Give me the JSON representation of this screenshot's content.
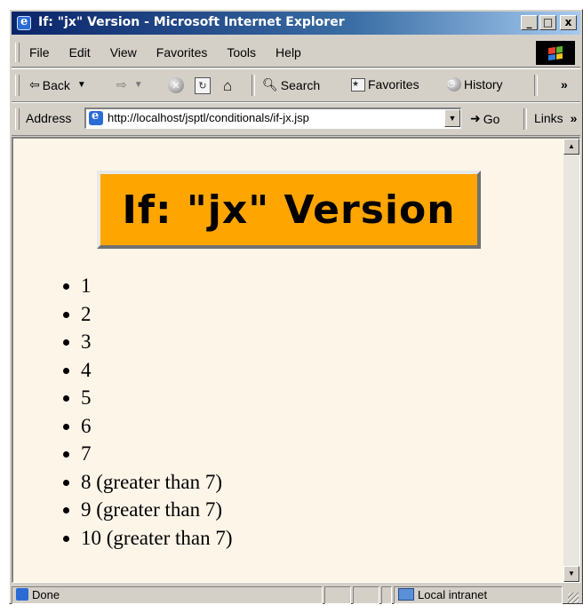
{
  "window": {
    "title": "If: \"jx\" Version - Microsoft Internet Explorer",
    "controls": {
      "minimize": "_",
      "maximize": "□",
      "close": "x"
    }
  },
  "menu": [
    "File",
    "Edit",
    "View",
    "Favorites",
    "Tools",
    "Help"
  ],
  "toolbar": {
    "back": "Back",
    "search": "Search",
    "favorites": "Favorites",
    "history": "History",
    "overflow": "»"
  },
  "address": {
    "label": "Address",
    "url": "http://localhost/jsptl/conditionals/if-jx.jsp",
    "go": "Go",
    "links": "Links",
    "links_overflow": "»"
  },
  "page": {
    "heading": "If: \"jx\" Version",
    "items": [
      "1",
      "2",
      "3",
      "4",
      "5",
      "6",
      "7",
      "8 (greater than 7)",
      "9 (greater than 7)",
      "10 (greater than 7)"
    ],
    "heading_bg": "#ffa500",
    "background": "#fdf5e8"
  },
  "status": {
    "left": "Done",
    "zone": "Local intranet"
  }
}
